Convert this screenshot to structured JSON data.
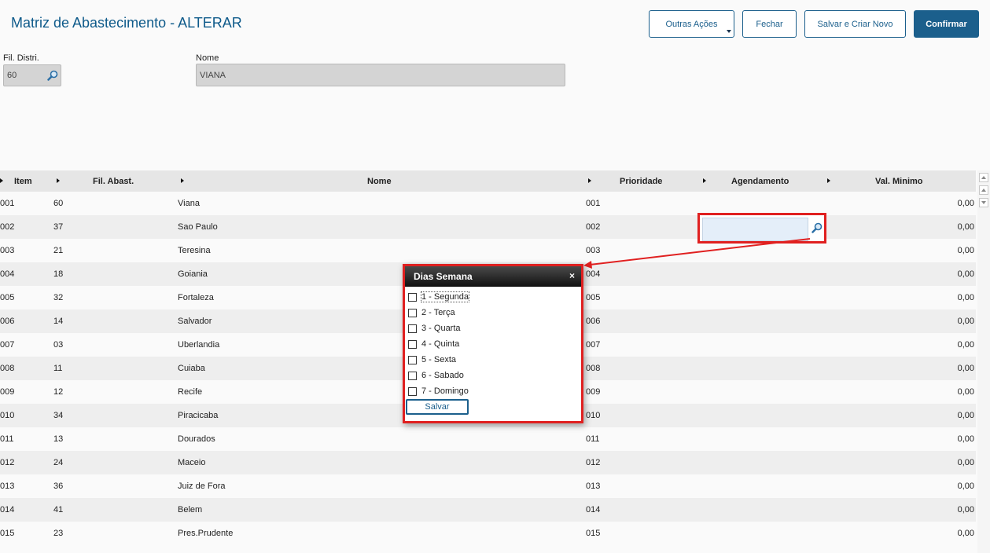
{
  "page": {
    "title": "Matriz de Abastecimento - ALTERAR"
  },
  "toolbar": {
    "other_actions": "Outras Ações",
    "close": "Fechar",
    "save_new": "Salvar e Criar Novo",
    "confirm": "Confirmar"
  },
  "form": {
    "fil_distri_label": "Fil. Distri.",
    "fil_distri_value": "60",
    "nome_label": "Nome",
    "nome_value": "VIANA"
  },
  "grid": {
    "columns": [
      "Item",
      "Fil. Abast.",
      "Nome",
      "Prioridade",
      "Agendamento",
      "Val. Minimo"
    ],
    "rows": [
      [
        "001",
        "60",
        "Viana",
        "001",
        "",
        "0,00"
      ],
      [
        "002",
        "37",
        "Sao Paulo",
        "002",
        "",
        "0,00"
      ],
      [
        "003",
        "21",
        "Teresina",
        "003",
        "",
        "0,00"
      ],
      [
        "004",
        "18",
        "Goiania",
        "004",
        "",
        "0,00"
      ],
      [
        "005",
        "32",
        "Fortaleza",
        "005",
        "",
        "0,00"
      ],
      [
        "006",
        "14",
        "Salvador",
        "006",
        "",
        "0,00"
      ],
      [
        "007",
        "03",
        "Uberlandia",
        "007",
        "",
        "0,00"
      ],
      [
        "008",
        "11",
        "Cuiaba",
        "008",
        "",
        "0,00"
      ],
      [
        "009",
        "12",
        "Recife",
        "009",
        "",
        "0,00"
      ],
      [
        "010",
        "34",
        "Piracicaba",
        "010",
        "",
        "0,00"
      ],
      [
        "011",
        "13",
        "Dourados",
        "011",
        "",
        "0,00"
      ],
      [
        "012",
        "24",
        "Maceio",
        "012",
        "",
        "0,00"
      ],
      [
        "013",
        "36",
        "Juiz de Fora",
        "013",
        "",
        "0,00"
      ],
      [
        "014",
        "41",
        "Belem",
        "014",
        "",
        "0,00"
      ],
      [
        "015",
        "23",
        "Pres.Prudente",
        "015",
        "",
        "0,00"
      ]
    ]
  },
  "popup": {
    "title": "Dias Semana",
    "close": "×",
    "options": [
      "1 - Segunda",
      "2 - Terça",
      "3 - Quarta",
      "4 - Quinta",
      "5 - Sexta",
      "6 - Sabado",
      "7 - Domingo"
    ],
    "save": "Salvar"
  },
  "colors": {
    "accent": "#1b5f8c",
    "highlight": "#e02020"
  }
}
